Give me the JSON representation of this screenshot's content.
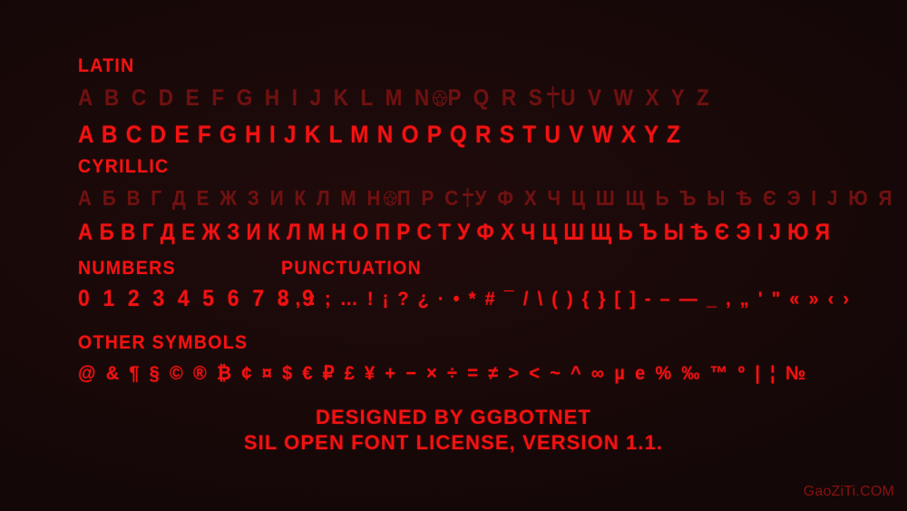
{
  "specimen": {
    "background_color": "#190909",
    "accent_bright": "#f21212",
    "accent_dim": "#6e1111",
    "watermark_color": "#8a1010"
  },
  "sections": {
    "latin": {
      "heading": "LATIN",
      "row_dim": "A B C D E F G H I J K L M N",
      "row_dim_tail": "P Q R S",
      "row_dim_tail2": "U V W X Y Z",
      "row_bright": "A B C D E F G H I J K L M N O P Q R S T U V W X Y Z",
      "substitutions": [
        {
          "letter": "O",
          "glyph": "pentagram-icon"
        },
        {
          "letter": "T",
          "glyph": "inverted-cross-icon"
        }
      ]
    },
    "cyrillic": {
      "heading": "CYRILLIC",
      "row_dim": "А Б В Г Д Е Ж З И К Л М Н",
      "row_dim_tail": "П Р С",
      "row_dim_tail2": "У Ф Х Ч Ц Ш Щ Ь Ъ Ы Ѣ Є Э І Ј Ю Я",
      "row_bright": "А Б В Г Д Е Ж З И К Л М Н О П Р С Т У Ф Х Ч Ц Ш Щ Ь Ъ Ы Ѣ Є Э І Ј Ю Я",
      "substitutions": [
        {
          "letter": "О",
          "glyph": "pentagram-icon"
        },
        {
          "letter": "Т",
          "glyph": "inverted-cross-icon"
        }
      ]
    },
    "numbers": {
      "heading": "NUMBERS",
      "row": "0 1 2 3 4 5 6 7 8 9"
    },
    "punctuation": {
      "heading": "PUNCTUATION",
      "row": ". , : ; … ! ¡ ? ¿ · • * # ¯ / \\ ( ) { } [ ] - – — _ , „ ' \" « » ‹ ›"
    },
    "other_symbols": {
      "heading": "OTHER SYMBOLS",
      "row": "@ & ¶ § © ® ₿ ¢ ¤ $ € ₽ £ ¥ + − × ÷ = ≠ > < ~ ^ ∞ µ е % ‰ ™ º | ¦ №"
    }
  },
  "footer": {
    "line1": "DESIGNED BY GGBOTNET",
    "line2": "SIL OPEN FONT LICENSE, VERSION 1.1."
  },
  "watermark": {
    "text": "GaoZiTi.COM"
  }
}
